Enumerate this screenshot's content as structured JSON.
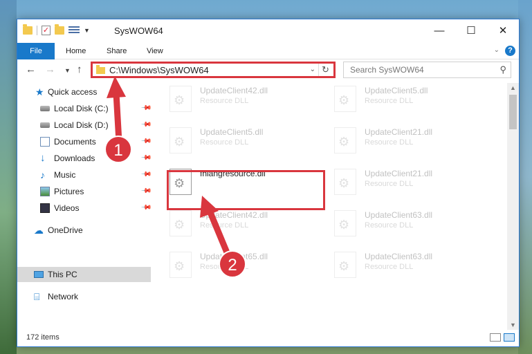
{
  "window": {
    "title": "SysWOW64",
    "controls": {
      "minimize": "—",
      "maximize": "☐",
      "close": "✕"
    }
  },
  "ribbon": {
    "tabs": [
      "File",
      "Home",
      "Share",
      "View"
    ],
    "help": "?"
  },
  "address": {
    "path": "C:\\Windows\\SysWOW64",
    "search_placeholder": "Search SysWOW64"
  },
  "sidebar": {
    "items": [
      {
        "label": "Quick access",
        "icon": "star-icon"
      },
      {
        "label": "Local Disk (C:)",
        "icon": "drive-icon",
        "pinned": true
      },
      {
        "label": "Local Disk (D:)",
        "icon": "drive-icon",
        "pinned": true
      },
      {
        "label": "Documents",
        "icon": "documents-icon",
        "pinned": true
      },
      {
        "label": "Downloads",
        "icon": "download-icon",
        "pinned": true
      },
      {
        "label": "Music",
        "icon": "music-icon",
        "pinned": true
      },
      {
        "label": "Pictures",
        "icon": "pictures-icon",
        "pinned": true
      },
      {
        "label": "Videos",
        "icon": "videos-icon",
        "pinned": true
      },
      {
        "label": "OneDrive",
        "icon": "cloud-icon"
      },
      {
        "label": "This PC",
        "icon": "computer-icon",
        "selected": true
      },
      {
        "label": "Network",
        "icon": "network-icon"
      }
    ]
  },
  "files": [
    {
      "name": "UpdateClient42.dll",
      "type": "Resource DLL"
    },
    {
      "name": "UpdateClient5.dll",
      "type": "Resource DLL"
    },
    {
      "name": "UpdateClient5.dll",
      "type": "Resource DLL"
    },
    {
      "name": "UpdateClient21.dll",
      "type": "Resource DLL"
    },
    {
      "name": "fhlangresource.dll",
      "type": ""
    },
    {
      "name": "UpdateClient21.dll",
      "type": "Resource DLL"
    },
    {
      "name": "UpdateClient42.dll",
      "type": "Resource DLL"
    },
    {
      "name": "UpdateClient63.dll",
      "type": "Resource DLL"
    },
    {
      "name": "UpdateClient65.dll",
      "type": "Resource DLL"
    },
    {
      "name": "UpdateClient63.dll",
      "type": "Resource DLL"
    }
  ],
  "status": {
    "count": "172 items"
  },
  "annotations": {
    "step1": "1",
    "step2": "2",
    "color": "#d9363e"
  }
}
